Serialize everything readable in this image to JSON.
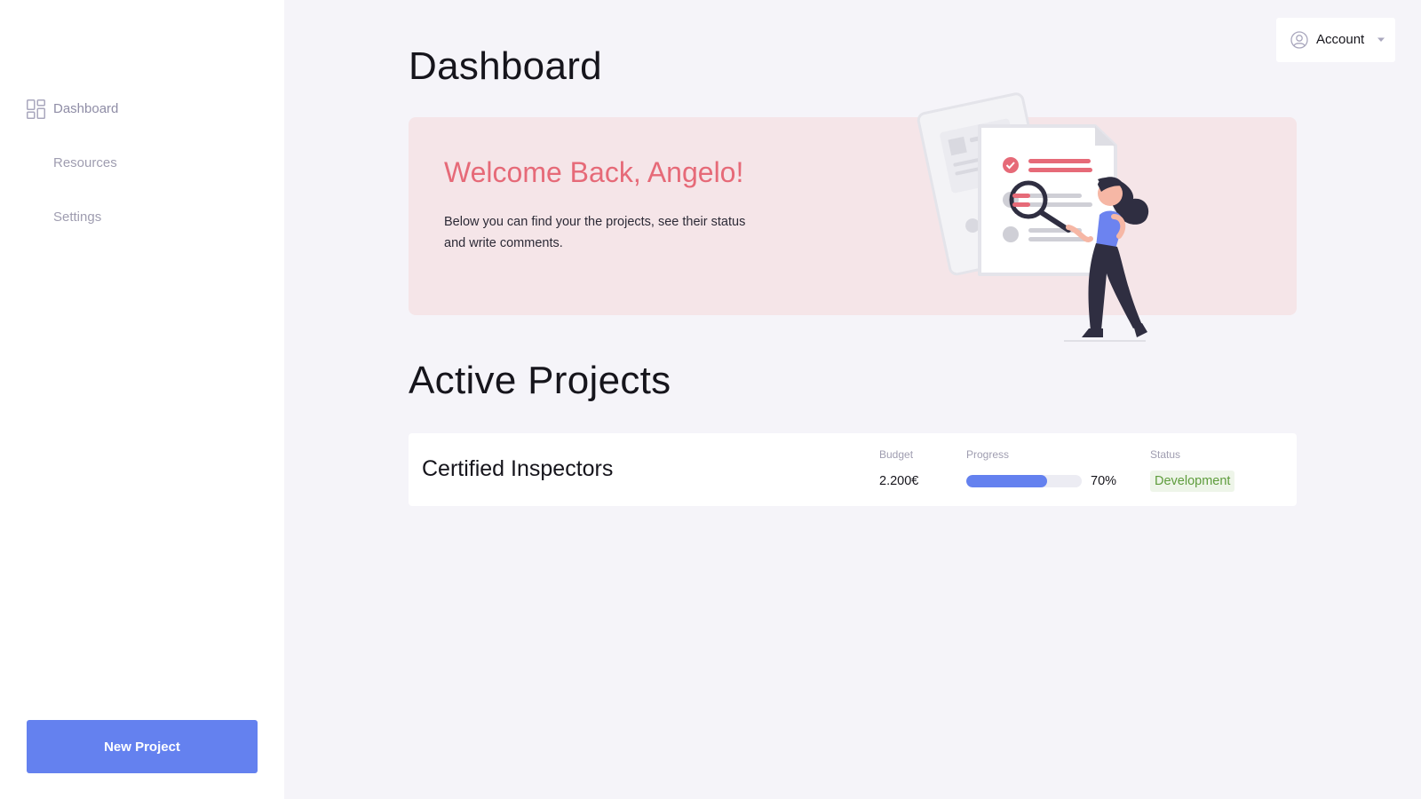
{
  "sidebar": {
    "items": [
      {
        "label": "Dashboard",
        "icon": "dashboard-grid-icon",
        "active": true
      },
      {
        "label": "Resources",
        "icon": null
      },
      {
        "label": "Settings",
        "icon": null
      }
    ],
    "new_project_label": "New Project"
  },
  "account": {
    "label": "Account",
    "icon": "user-circle-icon"
  },
  "main": {
    "title": "Dashboard",
    "hero": {
      "title": "Welcome Back, Angelo!",
      "text": "Below you can find your the projects, see their status and write comments."
    },
    "active_projects": {
      "title": "Active Projects",
      "columns": {
        "budget": "Budget",
        "progress": "Progress",
        "status": "Status"
      },
      "projects": [
        {
          "name": "Certified Inspectors",
          "budget": "2.200€",
          "progress_text": "70%",
          "progress": 0.7,
          "status": "Development"
        }
      ]
    }
  },
  "colors": {
    "accent": "#6481ef",
    "hero_bg": "#f5e5e8",
    "hero_title": "#e66a78",
    "status_green": "#5e9c3c",
    "status_bg": "#eef5e9",
    "page_bg": "#f5f4f9"
  }
}
